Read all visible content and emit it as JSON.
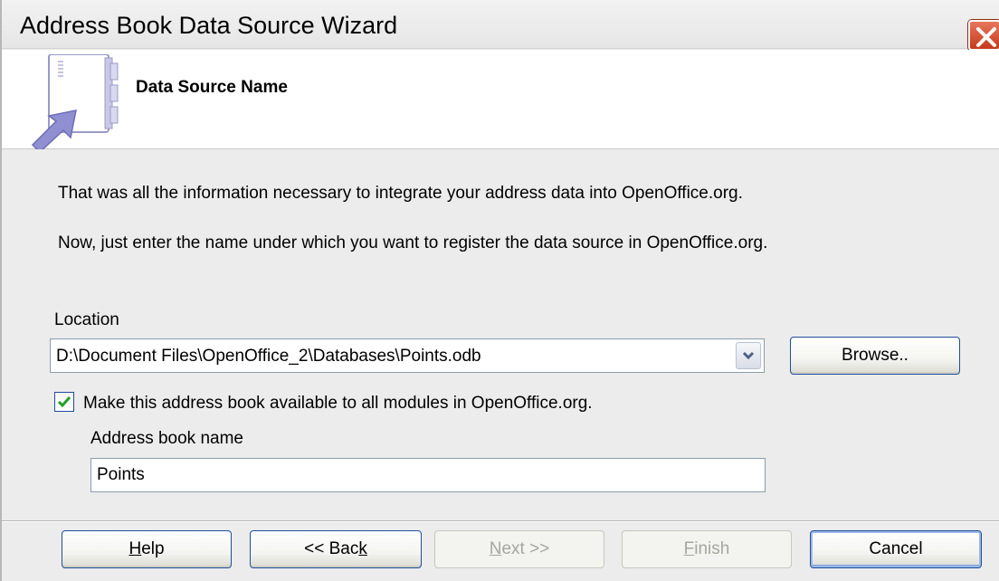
{
  "window": {
    "title": "Address Book Data Source Wizard"
  },
  "header": {
    "title": "Data Source Name",
    "icon": "address-book-icon"
  },
  "intro": {
    "line1": "That was all the information necessary to integrate your address data into OpenOffice.org.",
    "line2": "Now, just enter the name under which you want to register the data source in OpenOffice.org."
  },
  "location": {
    "label": "Location",
    "value": "D:\\Document Files\\OpenOffice_2\\Databases\\Points.odb",
    "browse_label": "Browse.."
  },
  "availability": {
    "checked": true,
    "label": "Make this address book available to all modules in OpenOffice.org."
  },
  "address_book": {
    "label": "Address book name",
    "value": "Points"
  },
  "buttons": {
    "help": {
      "before": "",
      "mnemonic": "H",
      "after": "elp"
    },
    "back": {
      "before": "<< Bac",
      "mnemonic": "k",
      "after": ""
    },
    "next": {
      "before": "",
      "mnemonic": "N",
      "after": "ext >>"
    },
    "finish": {
      "before": "",
      "mnemonic": "F",
      "after": "inish"
    },
    "cancel": "Cancel"
  },
  "colors": {
    "close_button": "#d4472a",
    "button_border": "#1f4e9b",
    "icon_purple": "#8f8fd1"
  }
}
